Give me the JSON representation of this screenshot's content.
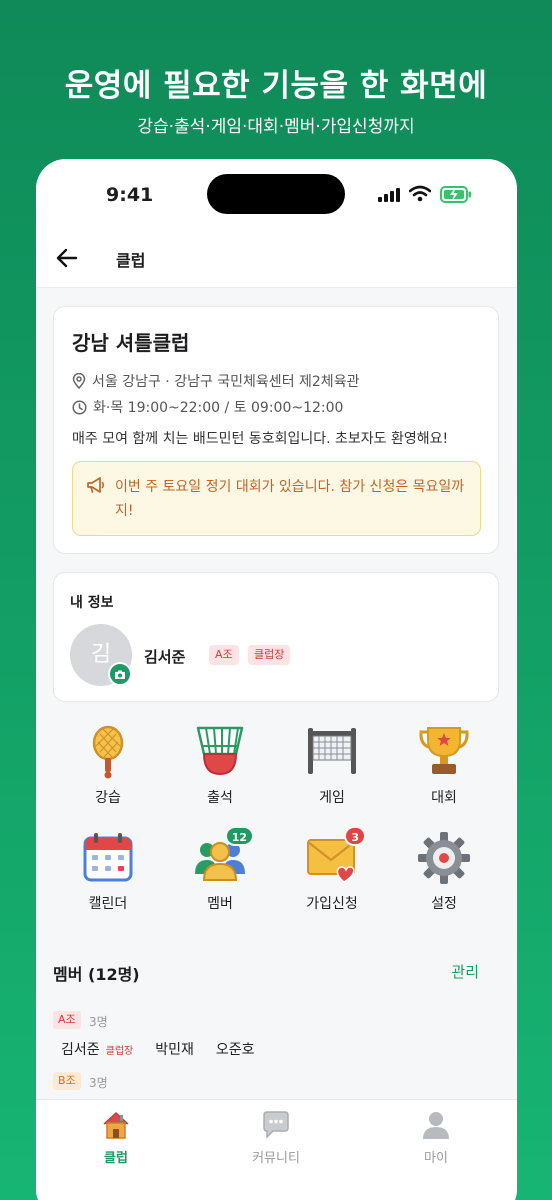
{
  "promo": {
    "title": "운영에 필요한 기능을 한 화면에",
    "subtitle": "강습·출석·게임·대회·멤버·가입신청까지"
  },
  "status_bar": {
    "time": "9:41"
  },
  "app_bar": {
    "title": "클럽"
  },
  "club": {
    "name": "강남 셔틀클럽",
    "location": "서울 강남구 · 강남구 국민체육센터 제2체육관",
    "hours": "화·목 19:00~22:00 / 토 09:00~12:00",
    "description": "매주 모여 함께 치는 배드민턴 동호회입니다. 초보자도 환영해요!",
    "notice": "이번 주 토요일 정기 대회가 있습니다. 참가 신청은 목요일까지!"
  },
  "my_info": {
    "heading": "내 정보",
    "avatar_initial": "김",
    "name": "김서준",
    "grade_badge": "A조",
    "role_badge": "클럽장"
  },
  "menu": [
    {
      "label": "강습",
      "icon": "racket-icon"
    },
    {
      "label": "출석",
      "icon": "shuttlecock-icon"
    },
    {
      "label": "게임",
      "icon": "net-icon"
    },
    {
      "label": "대회",
      "icon": "trophy-icon"
    },
    {
      "label": "캘린더",
      "icon": "calendar-icon"
    },
    {
      "label": "멤버",
      "icon": "members-icon",
      "badge": "12"
    },
    {
      "label": "가입신청",
      "icon": "envelope-icon",
      "badge": "3"
    },
    {
      "label": "설정",
      "icon": "gear-icon"
    }
  ],
  "members": {
    "title": "멤버 (12명)",
    "manage_label": "관리",
    "groups": [
      {
        "tag": "A조",
        "count": "3명",
        "members": [
          "김서준",
          "박민재",
          "오준호"
        ],
        "leader_label": "클럽장"
      },
      {
        "tag": "B조",
        "count": "3명"
      }
    ]
  },
  "tabs": [
    {
      "label": "클럽",
      "icon": "house-icon",
      "active": true
    },
    {
      "label": "커뮤니티",
      "icon": "chat-icon",
      "active": false
    },
    {
      "label": "마이",
      "icon": "person-icon",
      "active": false
    }
  ],
  "colors": {
    "brand_green": "#1f9a62",
    "notice_text": "#c0652a",
    "badge_red": "#e04444"
  }
}
